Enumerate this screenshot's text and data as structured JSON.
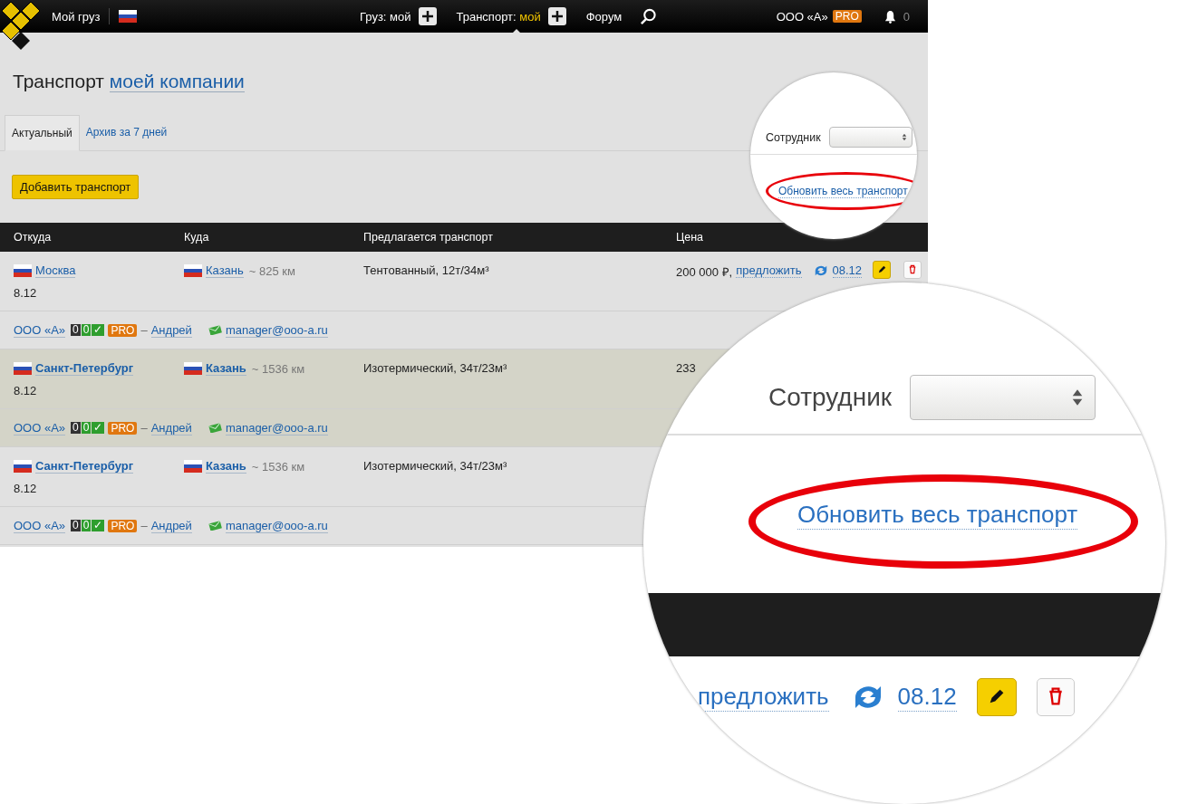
{
  "header": {
    "my_cargo": "Мой груз",
    "nav": [
      {
        "label": "Груз:",
        "value": "мой",
        "selected": false
      },
      {
        "label": "Транспорт:",
        "value": "мой",
        "selected": true
      }
    ],
    "forum": "Форум",
    "company": "ООО «А»",
    "pro": "PRO",
    "notifications": "0"
  },
  "title": "Транспорт",
  "title_link": "моей компании",
  "tabs": [
    {
      "label": "Актуальный",
      "selected": true
    },
    {
      "label": "Архив за 7 дней",
      "selected": false
    }
  ],
  "filter": {
    "label": "Сотрудник"
  },
  "add_button": "Добавить транспорт",
  "refresh_all": "Обновить весь транспорт",
  "columns": [
    "Откуда",
    "Куда",
    "Предлагается транспорт",
    "Цена"
  ],
  "rows": [
    {
      "from": "Москва",
      "to": "Казань",
      "distance": "~ 825 км",
      "date": "8.12",
      "transport": "Тентованный, 12т/34м³",
      "price": "200 000 ₽,",
      "offer": "предложить",
      "updated": "08.12",
      "highlighted": false,
      "bold_cities": false,
      "company": "ООО «А»",
      "rating": [
        {
          "text": "0",
          "color": "#333333"
        },
        {
          "text": "0",
          "color": "#2e9e2e"
        },
        {
          "text": "✓",
          "color": "#2e9e2e"
        }
      ],
      "pro": "PRO",
      "dash": "–",
      "contact": "Андрей",
      "email": "manager@ooo-a.ru"
    },
    {
      "from": "Санкт-Петербург",
      "to": "Казань",
      "distance": "~ 1536 км",
      "date": "8.12",
      "transport": "Изотермический, 34т/23м³",
      "price": "233",
      "highlighted": true,
      "bold_cities": true,
      "company": "ООО «А»",
      "rating": [
        {
          "text": "0",
          "color": "#333333"
        },
        {
          "text": "0",
          "color": "#2e9e2e"
        },
        {
          "text": "✓",
          "color": "#2e9e2e"
        }
      ],
      "pro": "PRO",
      "dash": "–",
      "contact": "Андрей",
      "email": "manager@ooo-a.ru"
    },
    {
      "from": "Санкт-Петербург",
      "to": "Казань",
      "distance": "~ 1536 км",
      "date": "8.12",
      "transport": "Изотермический, 34т/23м³",
      "highlighted": false,
      "bold_cities": true,
      "company": "ООО «А»",
      "rating": [
        {
          "text": "0",
          "color": "#333333"
        },
        {
          "text": "0",
          "color": "#2e9e2e"
        },
        {
          "text": "✓",
          "color": "#2e9e2e"
        }
      ],
      "pro": "PRO",
      "dash": "–",
      "contact": "Андрей",
      "email": "manager@ooo-a.ru"
    }
  ],
  "magnifier": {
    "filter_label": "Сотрудник",
    "refresh_all": "Обновить весь транспорт",
    "offer": "предложить",
    "updated": "08.12"
  }
}
